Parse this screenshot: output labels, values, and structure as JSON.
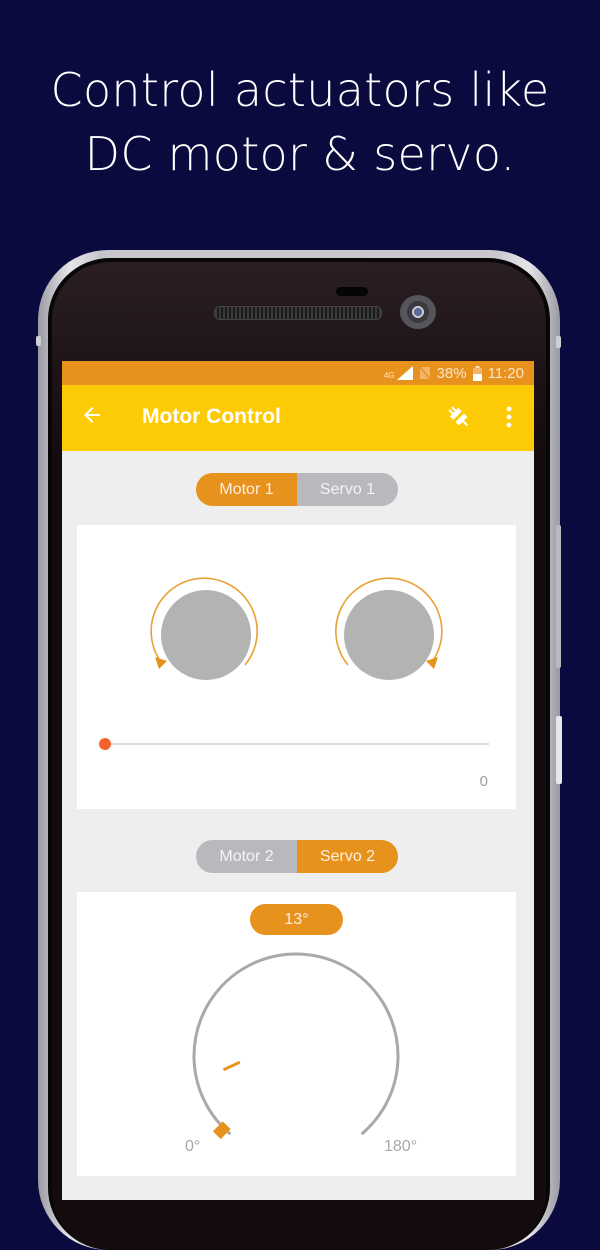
{
  "headline": {
    "line1": "Control actuators like",
    "line2": "DC motor & servo."
  },
  "status_bar": {
    "network": "4G",
    "battery": "38%",
    "time": "11:20"
  },
  "app_bar": {
    "title": "Motor Control",
    "back_icon": "arrow-left-icon",
    "connect_icon": "plug-icon",
    "menu_icon": "more-vert-icon"
  },
  "panel1": {
    "tabs": [
      {
        "label": "Motor 1",
        "selected": true
      },
      {
        "label": "Servo 1",
        "selected": false
      }
    ],
    "knobs": [
      {
        "name": "counter-clockwise",
        "icon": "rotate-ccw-icon"
      },
      {
        "name": "clockwise",
        "icon": "rotate-cw-icon"
      }
    ],
    "speed_slider": {
      "value": 0,
      "fraction": 0.0,
      "value_label": "0"
    }
  },
  "panel2": {
    "tabs": [
      {
        "label": "Motor 2",
        "selected": false
      },
      {
        "label": "Servo 2",
        "selected": true
      }
    ],
    "servo": {
      "angle": 13,
      "angle_label": "13°",
      "min_label": "0°",
      "max_label": "180°",
      "min": 0,
      "max": 180
    }
  },
  "colors": {
    "background": "#0a0a3e",
    "status_bar": "#e8921e",
    "app_bar": "#fccb06",
    "accent": "#e8921e",
    "slider_thumb": "#f4622e",
    "inactive": "#b9b9bd"
  }
}
